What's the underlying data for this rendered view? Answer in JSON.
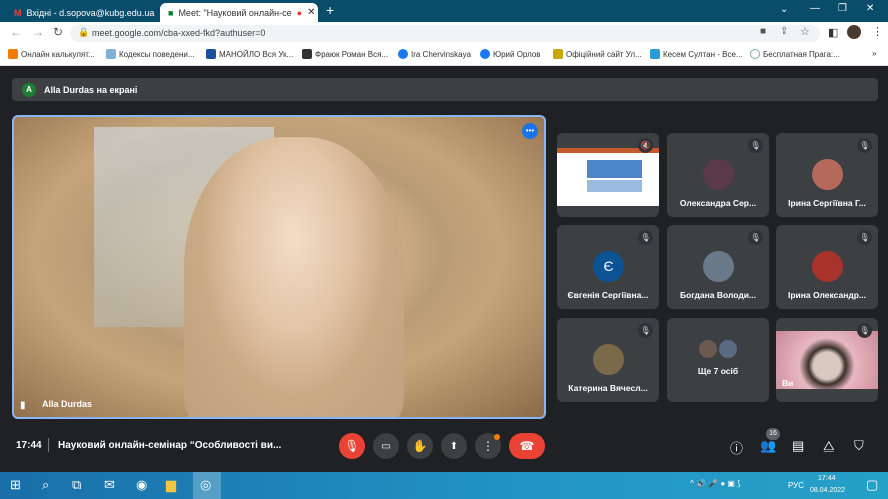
{
  "browser": {
    "tabs": [
      {
        "title": "Вхідні - d.sopova@kubg.edu.ua",
        "active": false
      },
      {
        "title": "Meet: \"Науковий онлайн-се",
        "active": true
      }
    ],
    "new_tab": "+",
    "url": "meet.google.com/cba-xxed-fkd?authuser=0",
    "bookmarks": [
      "Онлайн калькулят...",
      "Кодексы поведени...",
      "МАНОЙЛО Вся Ук...",
      "Фраюк Роман Вся...",
      "Ira Chervinskaya",
      "Юрий Орлов",
      "Офіційний сайт Ул...",
      "Кесем Султан - Все...",
      "Бесплатная Прага:..."
    ],
    "bookmarks_more": "»"
  },
  "meet": {
    "banner": {
      "avatar": "A",
      "text": "Alla Durdas на екрані"
    },
    "main_video": {
      "name": "Alla Durdas"
    },
    "tiles": [
      {
        "name": "Alla Durdas",
        "type": "screen"
      },
      {
        "name": "Олександра Сер...",
        "color": "#5a3a48"
      },
      {
        "name": "Ірина Сергіївна Г...",
        "color": "#b5695a"
      },
      {
        "name": "Євгенія Сергіївна...",
        "initial": "Є",
        "color": "#0b5394"
      },
      {
        "name": "Богдана Володи...",
        "color": "#6b7a8a"
      },
      {
        "name": "Ірина Олександр...",
        "color": "#a8332a"
      },
      {
        "name": "Катерина Вячесл...",
        "color": "#7a6a4a"
      },
      {
        "name": "Ще 7 осіб",
        "type": "more"
      },
      {
        "name": "Ви",
        "type": "self"
      }
    ],
    "bottom": {
      "time": "17:44",
      "title": "Науковий онлайн-семінар “Особливості ви...",
      "participants_count": "16"
    }
  },
  "taskbar": {
    "lang": "РУС",
    "time": "17:44",
    "date": "08.04.2022"
  },
  "colors": {
    "accent": "#8ab4f8",
    "end_call": "#ea4335",
    "tabbar": "#0a4d6b"
  }
}
